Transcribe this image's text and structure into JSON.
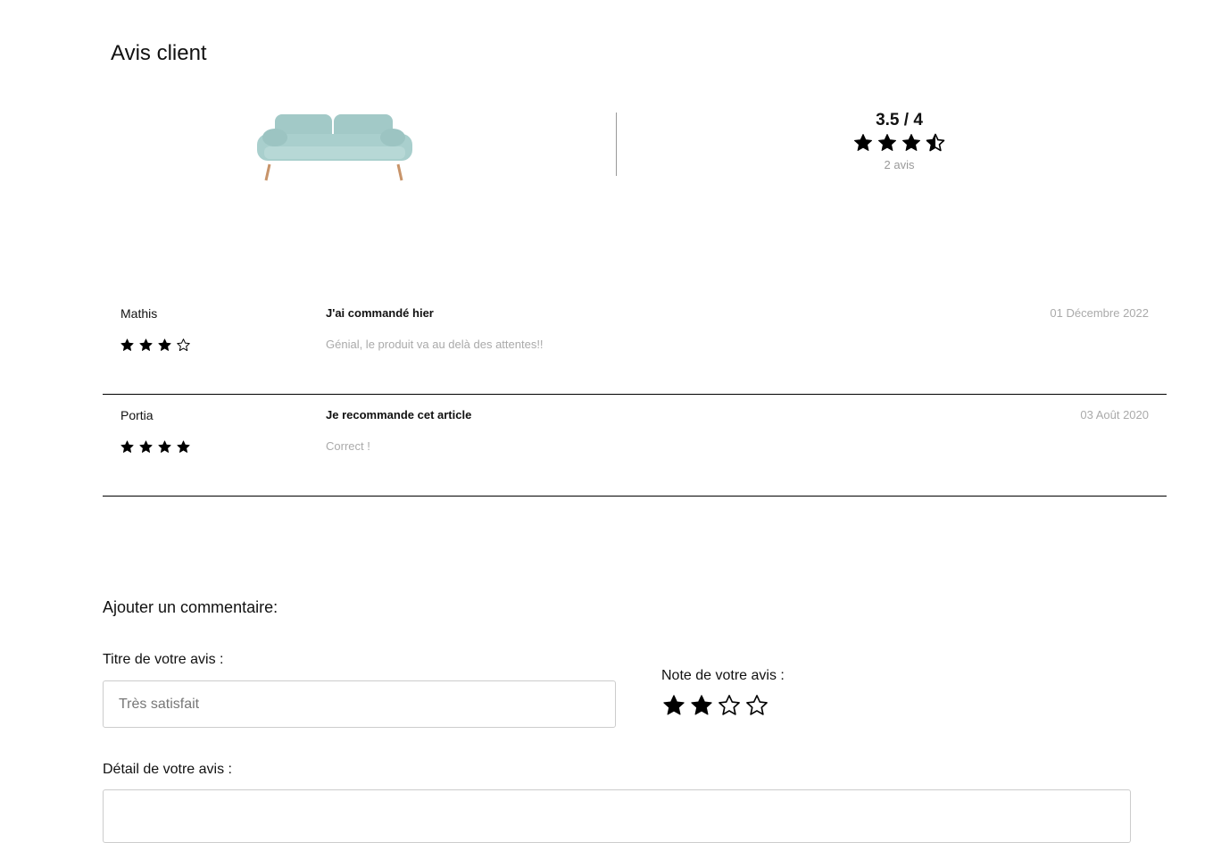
{
  "page": {
    "title": "Avis client"
  },
  "product": {
    "image_alt": "sofa-image"
  },
  "summary": {
    "score_text": "3.5 / 4",
    "rating": 3.5,
    "max": 4,
    "count_text": "2 avis"
  },
  "reviews": [
    {
      "author": "Mathis",
      "rating": 3,
      "max": 4,
      "title": "J'ai commandé hier",
      "text": "Génial, le produit va au delà des attentes!!",
      "date": "01 Décembre 2022"
    },
    {
      "author": "Portia",
      "rating": 4,
      "max": 4,
      "title": "Je recommande cet article",
      "text": "Correct !",
      "date": "03 Août 2020"
    }
  ],
  "form": {
    "heading": "Ajouter un commentaire:",
    "title_label": "Titre de votre avis :",
    "title_placeholder": "Très satisfait",
    "rating_label": "Note de votre avis :",
    "rating_value": 2,
    "rating_max": 4,
    "detail_label": "Détail de votre avis :"
  },
  "colors": {
    "text": "#111111",
    "muted": "#aaaaaa",
    "sofa": "#a9cfcd",
    "sofa_leg": "#c8946a"
  }
}
